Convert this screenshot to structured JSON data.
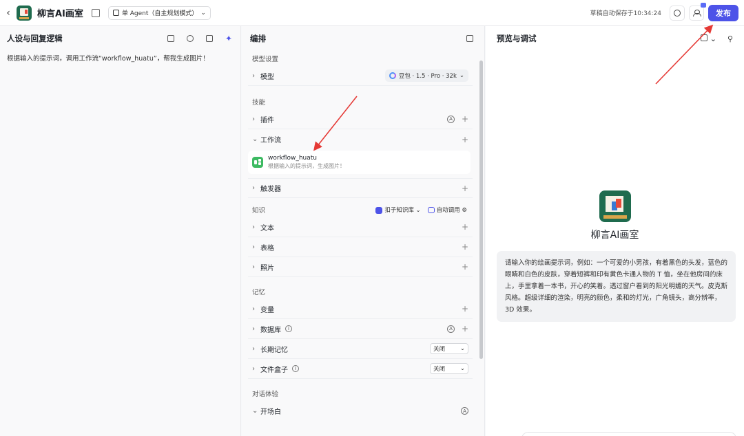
{
  "header": {
    "back_icon": "chevron-left-icon",
    "app_title": "柳言AI画室",
    "mode_label": "单 Agent（自主规划模式）",
    "save_status": "草稿自动保存于10:34:24",
    "publish_label": "发布"
  },
  "left": {
    "title": "人设与回复逻辑",
    "prompt": "根据输入的提示词，调用工作流“workflow_huatu”，帮我生成图片！"
  },
  "middle": {
    "title": "编排",
    "model_section": "模型设置",
    "model_label": "模型",
    "model_value": "豆包 · 1.5 · Pro · 32k",
    "skills_section": "技能",
    "plugin_label": "插件",
    "workflow_label": "工作流",
    "workflow_name": "workflow_huatu",
    "workflow_desc": "根据输入的提示词，生成图片！",
    "trigger_label": "触发器",
    "knowledge_section": "知识",
    "kb_source": "扣子知识库",
    "kb_auto": "自动调用",
    "text_label": "文本",
    "table_label": "表格",
    "photo_label": "照片",
    "memory_section": "记忆",
    "variable_label": "变量",
    "database_label": "数据库",
    "long_memory_label": "长期记忆",
    "long_memory_value": "关闭",
    "filebox_label": "文件盒子",
    "filebox_value": "关闭",
    "dialog_section": "对话体验",
    "opening_label": "开场白"
  },
  "right": {
    "title": "预览与调试",
    "bot_name": "柳言AI画室",
    "opening_message": "请输入你的绘画提示词，例如：一个可爱的小男孩，有着黑色的头发，蓝色的眼睛和白色的皮肤，穿着短裤和印有黄色卡通人物的 T 恤，坐在他房间的床上，手里拿着一本书，开心的笑着。透过窗户看到的阳光明媚的天气。皮克斯风格。超级详细的渲染，明亮的颜色，柔和的灯光，广角镜头，高分辨率，3D 效果。"
  },
  "colors": {
    "accent": "#4d53e8",
    "annotation_arrow": "#e53935"
  }
}
